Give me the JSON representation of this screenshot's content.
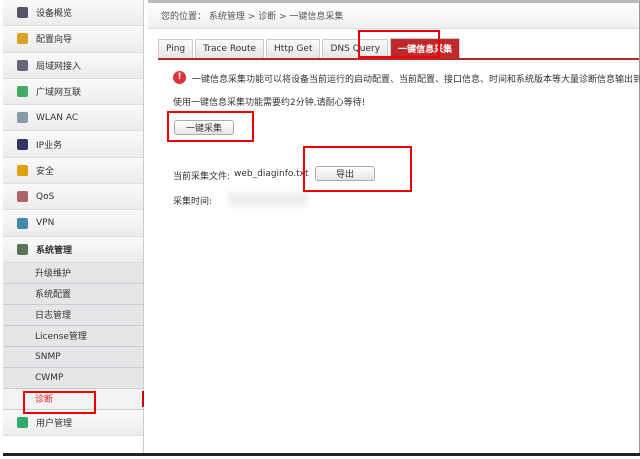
{
  "sidebar": {
    "items": [
      {
        "label": "设备概览",
        "icon": "device-overview-icon",
        "color": "#556"
      },
      {
        "label": "配置向导",
        "icon": "config-wizard-icon",
        "color": "#e0a020"
      },
      {
        "label": "局域网接入",
        "icon": "lan-icon",
        "color": "#667"
      },
      {
        "label": "广域网互联",
        "icon": "wan-icon",
        "color": "#4a6"
      },
      {
        "label": "WLAN AC",
        "icon": "wlan-icon",
        "color": "#89a"
      },
      {
        "label": "IP业务",
        "icon": "ip-service-icon",
        "color": "#336"
      },
      {
        "label": "安全",
        "icon": "shield-icon",
        "color": "#e0a010"
      },
      {
        "label": "QoS",
        "icon": "qos-icon",
        "color": "#a66"
      },
      {
        "label": "VPN",
        "icon": "vpn-icon",
        "color": "#48a"
      },
      {
        "label": "系统管理",
        "icon": "system-icon",
        "color": "#575"
      }
    ],
    "sub_items": [
      "升级维护",
      "系统配置",
      "日志管理",
      "License管理",
      "SNMP",
      "CWMP",
      "诊断"
    ],
    "last": {
      "label": "用户管理",
      "icon": "user-icon",
      "color": "#3a6"
    }
  },
  "breadcrumb": "您的位置： 系统管理 > 诊断 > 一键信息采集",
  "tabs": [
    "Ping",
    "Trace Route",
    "Http Get",
    "DNS Query",
    "一键信息采集"
  ],
  "content": {
    "warning": "一键信息采集功能可以将设备当前运行的启动配置、当前配置、接口信息、时间和系统版本等大量诊断信息输出到 web",
    "note": "使用一键信息采集功能需要约2分钟,请耐心等待!",
    "collect_button": "一键采集",
    "file_label": "当前采集文件:",
    "file_name": "web_diaginfo.txt",
    "export_button": "导出",
    "time_label": "采集时间:"
  }
}
